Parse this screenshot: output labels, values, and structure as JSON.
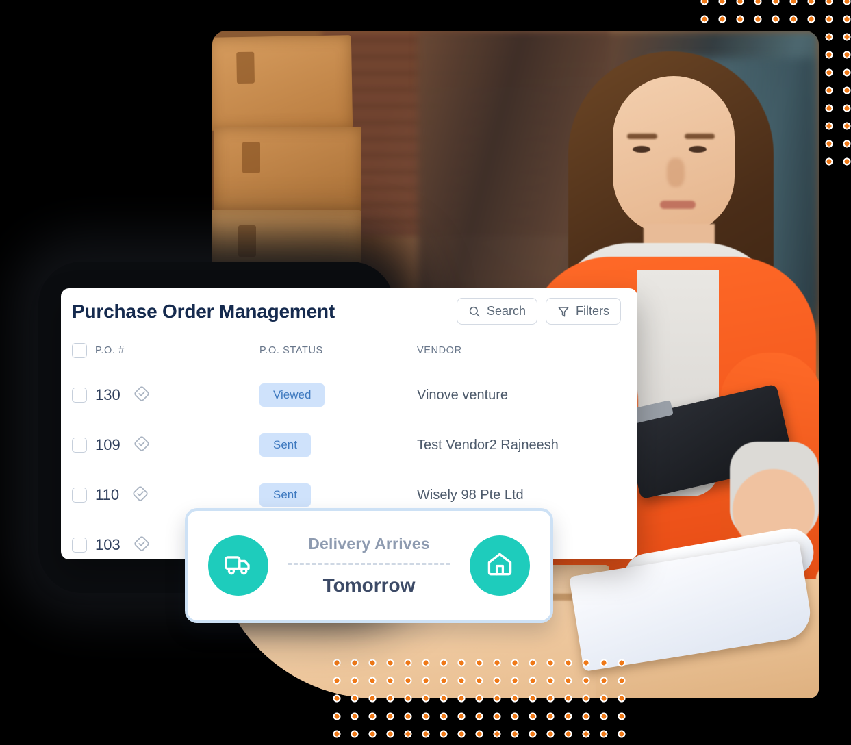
{
  "card": {
    "title": "Purchase Order Management",
    "actions": [
      {
        "label": "Search",
        "icon": "search-icon"
      },
      {
        "label": "Filters",
        "icon": "filter-icon"
      }
    ],
    "columns": {
      "po": "P.O. #",
      "status": "P.O. STATUS",
      "vendor": "VENDOR"
    },
    "rows": [
      {
        "po": "130",
        "status": "Viewed",
        "vendor": "Vinove venture",
        "icon": "verified-diamond-icon"
      },
      {
        "po": "109",
        "status": "Sent",
        "vendor": "Test Vendor2 Rajneesh",
        "icon": "verified-diamond-icon"
      },
      {
        "po": "110",
        "status": "Sent",
        "vendor": "Wisely 98 Pte Ltd",
        "icon": "verified-diamond-icon"
      },
      {
        "po": "103",
        "status": "",
        "vendor": "",
        "icon": "verified-diamond-icon"
      }
    ]
  },
  "delivery": {
    "label": "Delivery Arrives",
    "value": "Tomorrow",
    "left_icon": "truck-icon",
    "right_icon": "home-icon"
  },
  "colors": {
    "accent_teal": "#1ECCBC",
    "badge_bg": "#CFE2FB",
    "badge_text": "#3E79BF",
    "title": "#152A4E",
    "dot_orange": "#EF7918",
    "background": "#000000"
  }
}
